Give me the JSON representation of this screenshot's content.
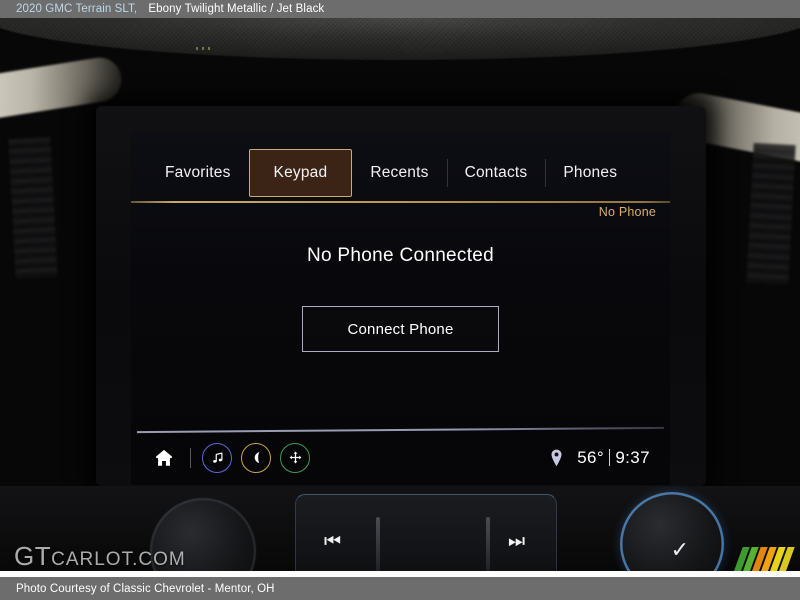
{
  "titlebar": {
    "vehicle": "2020 GMC Terrain SLT,",
    "separator": "",
    "colors": "Ebony Twilight Metallic / Jet Black"
  },
  "screen": {
    "tabs": [
      {
        "label": "Favorites",
        "active": false
      },
      {
        "label": "Keypad",
        "active": true
      },
      {
        "label": "Recents",
        "active": false
      },
      {
        "label": "Contacts",
        "active": false
      },
      {
        "label": "Phones",
        "active": false
      }
    ],
    "status_text": "No Phone",
    "message": "No Phone Connected",
    "connect_button": "Connect Phone",
    "dock": {
      "icons": [
        {
          "name": "home-icon",
          "ring": false,
          "color": "#ffffff"
        },
        {
          "name": "music-note-icon",
          "ring": true,
          "color": "#5a68d8"
        },
        {
          "name": "phone-icon",
          "ring": true,
          "color": "#c9a24a"
        },
        {
          "name": "navigation-icon",
          "ring": true,
          "color": "#3f9a52"
        }
      ],
      "location_icon": "location-pin-icon",
      "temperature": "56°",
      "time": "9:37"
    }
  },
  "console": {
    "prev_track_icon": "⏮",
    "next_track_icon": "⏭",
    "confirm_icon": "✓",
    "up_icon": "▲"
  },
  "watermark": {
    "prefix": "GT",
    "suffix": "CARLOT.COM",
    "stripe_colors": [
      "#3c9a2f",
      "#57b031",
      "#e2860f",
      "#f0a310",
      "#e8d31a",
      "#d9c81d"
    ]
  },
  "footer": {
    "credit": "Photo Courtesy of Classic Chevrolet - Mentor, OH"
  }
}
